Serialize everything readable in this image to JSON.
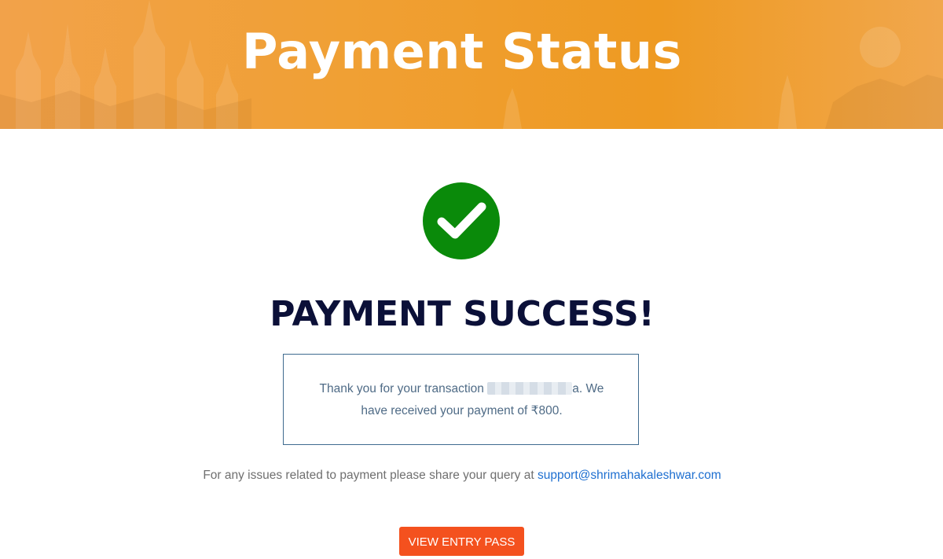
{
  "header": {
    "title": "Payment Status"
  },
  "status": {
    "icon": "check-circle-icon",
    "icon_color": "#0a8a0a",
    "heading": "PAYMENT SUCCESS!"
  },
  "message": {
    "line_start": "Thank you for your transaction ",
    "transaction_id_suffix": "a",
    "line_end": ". We have received your payment of ₹800."
  },
  "support": {
    "text": "For any issues related to payment please share your query at ",
    "email": "support@shrimahakaleshwar.com"
  },
  "actions": {
    "view_entry_pass": "VIEW ENTRY PASS"
  },
  "colors": {
    "header_orange": "#f0a035",
    "heading_navy": "#0b1038",
    "button_orange": "#f4511e",
    "link_blue": "#1e6fd0"
  }
}
